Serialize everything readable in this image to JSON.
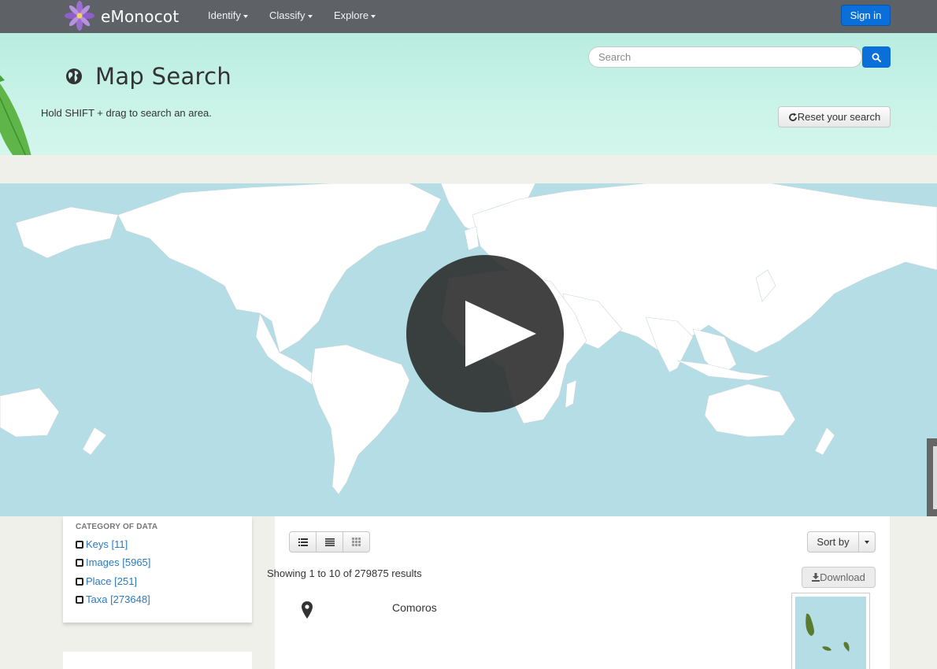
{
  "navbar": {
    "brand": "eMonocot",
    "menus": [
      {
        "label": "Identify"
      },
      {
        "label": "Classify"
      },
      {
        "label": "Explore"
      }
    ],
    "sign_in_label": "Sign in",
    "logo_icon": "flower-logo-icon"
  },
  "header": {
    "title": "Map Search",
    "title_icon": "globe-icon",
    "hint": "Hold SHIFT + drag to search an area.",
    "search_placeholder": "Search",
    "search_icon": "search-icon",
    "reset_label": "Reset your search",
    "reset_icon": "refresh-icon"
  },
  "map": {
    "play_icon": "play-icon",
    "ocean_color": "#b5dde6",
    "land_color": "#ffffff"
  },
  "facets": {
    "title": "CATEGORY OF DATA",
    "items": [
      {
        "label": "Keys [11]"
      },
      {
        "label": "Images [5965]"
      },
      {
        "label": "Place [251]"
      },
      {
        "label": "Taxa [273648]"
      }
    ]
  },
  "results": {
    "view_icons": [
      "list-icon",
      "detail-list-icon",
      "grid-icon"
    ],
    "sort_label": "Sort by",
    "showing": "Showing 1 to 10 of 279875 results",
    "download_label": "Download",
    "download_icon": "download-icon",
    "items": [
      {
        "title": "Comoros",
        "icon": "map-pin-icon"
      }
    ]
  },
  "colors": {
    "accent": "#0a6fd8",
    "navbar": "#5e6266",
    "header": "#c9f3e8",
    "link": "#2a7ac0"
  }
}
